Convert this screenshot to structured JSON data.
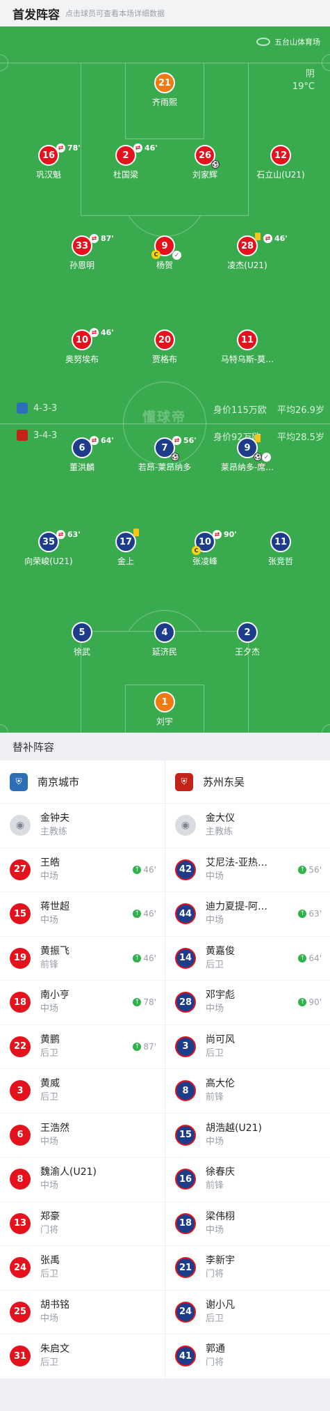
{
  "header": {
    "title": "首发阵容",
    "subtitle": "点击球员可查看本场详细数据"
  },
  "pitch": {
    "venue": "五台山体育场",
    "weather": "阴",
    "temperature": "19°C",
    "watermark": "懂球帝",
    "home_form": {
      "formation": "4-3-3",
      "value": "身价115万欧",
      "avg_age": "平均26.9岁"
    },
    "away_form": {
      "formation": "3-4-3",
      "value": "身价92万欧",
      "avg_age": "平均28.5岁"
    }
  },
  "home_players": [
    {
      "num": "21",
      "name": "齐雨熙",
      "kind": "gk"
    },
    {
      "num": "16",
      "name": "巩汉魁",
      "kind": "red",
      "sub": "78'"
    },
    {
      "num": "2",
      "name": "杜国梁",
      "kind": "red",
      "sub": "46'"
    },
    {
      "num": "26",
      "name": "刘家辉",
      "kind": "red",
      "goal": true
    },
    {
      "num": "12",
      "name": "石立山(U21)",
      "kind": "red"
    },
    {
      "num": "33",
      "name": "孙恩明",
      "kind": "red",
      "sub": "87'"
    },
    {
      "num": "9",
      "name": "杨贺",
      "kind": "red",
      "captain": true,
      "assist": true
    },
    {
      "num": "28",
      "name": "凌杰(U21)",
      "kind": "red",
      "sub": "46'",
      "yellow": true
    },
    {
      "num": "10",
      "name": "奥努埃布",
      "kind": "red",
      "sub": "46'"
    },
    {
      "num": "20",
      "name": "贾格布",
      "kind": "red"
    },
    {
      "num": "11",
      "name": "马特乌斯-莫…",
      "kind": "red"
    }
  ],
  "away_players": [
    {
      "num": "6",
      "name": "董洪麟",
      "kind": "blue",
      "sub": "64'"
    },
    {
      "num": "7",
      "name": "若昂-莱昂纳多",
      "kind": "blue",
      "sub": "56'",
      "goal": true
    },
    {
      "num": "9",
      "name": "莱昂纳多-席…",
      "kind": "blue",
      "yellow": true,
      "goal": true,
      "assist": true
    },
    {
      "num": "35",
      "name": "向荣峻(U21)",
      "kind": "blue",
      "sub": "63'"
    },
    {
      "num": "17",
      "name": "金上",
      "kind": "blue",
      "yellow": true
    },
    {
      "num": "10",
      "name": "张凌峰",
      "kind": "blue",
      "sub": "90'",
      "captain": true
    },
    {
      "num": "11",
      "name": "张竞哲",
      "kind": "blue"
    },
    {
      "num": "5",
      "name": "徐武",
      "kind": "blue"
    },
    {
      "num": "4",
      "name": "延济民",
      "kind": "blue"
    },
    {
      "num": "2",
      "name": "王夕杰",
      "kind": "blue"
    },
    {
      "num": "1",
      "name": "刘宇",
      "kind": "gk"
    }
  ],
  "bench": {
    "title": "替补阵容",
    "home": {
      "team": "南京城市",
      "coach_name": "金钟夫",
      "coach_role": "主教练",
      "players": [
        {
          "num": "27",
          "name": "王皓",
          "pos": "中场",
          "in": "46'"
        },
        {
          "num": "15",
          "name": "蒋世超",
          "pos": "中场",
          "in": "46'"
        },
        {
          "num": "19",
          "name": "黄振飞",
          "pos": "前锋",
          "in": "46'"
        },
        {
          "num": "18",
          "name": "南小亨",
          "pos": "中场",
          "in": "78'"
        },
        {
          "num": "22",
          "name": "黄鹏",
          "pos": "后卫",
          "in": "87'"
        },
        {
          "num": "3",
          "name": "黄威",
          "pos": "后卫"
        },
        {
          "num": "6",
          "name": "王浩然",
          "pos": "中场"
        },
        {
          "num": "8",
          "name": "魏渝人(U21)",
          "pos": "中场"
        },
        {
          "num": "13",
          "name": "郑豪",
          "pos": "门将"
        },
        {
          "num": "24",
          "name": "张禹",
          "pos": "后卫"
        },
        {
          "num": "25",
          "name": "胡书铭",
          "pos": "中场"
        },
        {
          "num": "31",
          "name": "朱启文",
          "pos": "后卫"
        }
      ]
    },
    "away": {
      "team": "苏州东吴",
      "coach_name": "金大仪",
      "coach_role": "主教练",
      "players": [
        {
          "num": "42",
          "name": "艾尼法-亚热…",
          "pos": "中场",
          "in": "56'"
        },
        {
          "num": "44",
          "name": "迪力夏提-阿…",
          "pos": "中场",
          "in": "63'"
        },
        {
          "num": "14",
          "name": "黄嘉俊",
          "pos": "后卫",
          "in": "64'"
        },
        {
          "num": "28",
          "name": "邓宇彪",
          "pos": "中场",
          "in": "90'"
        },
        {
          "num": "3",
          "name": "尚可风",
          "pos": "后卫"
        },
        {
          "num": "8",
          "name": "高大伦",
          "pos": "前锋"
        },
        {
          "num": "15",
          "name": "胡浩越(U21)",
          "pos": "中场"
        },
        {
          "num": "16",
          "name": "徐春庆",
          "pos": "前锋"
        },
        {
          "num": "18",
          "name": "梁伟栩",
          "pos": "中场"
        },
        {
          "num": "21",
          "name": "李新宇",
          "pos": "门将"
        },
        {
          "num": "24",
          "name": "谢小凡",
          "pos": "后卫"
        },
        {
          "num": "41",
          "name": "郭通",
          "pos": "门将"
        }
      ]
    }
  },
  "colors": {
    "pitch": "#3aaa4e",
    "home": "#e4121c",
    "away": "#1d3d8a",
    "keeper": "#f07a12",
    "sub_in": "#2fb24c"
  }
}
